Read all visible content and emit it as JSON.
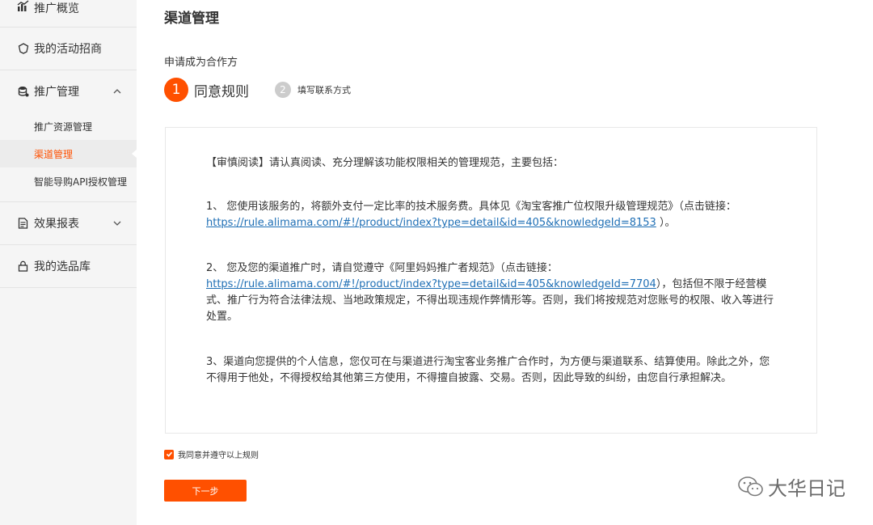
{
  "sidebar": {
    "overview": "推广概览",
    "activity": "我的活动招商",
    "promo_manage": "推广管理",
    "promo_sub": [
      {
        "label": "推广资源管理",
        "active": false
      },
      {
        "label": "渠道管理",
        "active": true
      },
      {
        "label": "智能导购API授权管理",
        "active": false
      }
    ],
    "report": "效果报表",
    "library": "我的选品库"
  },
  "main": {
    "title": "渠道管理",
    "section_title": "申请成为合作方",
    "steps": [
      {
        "num": "1",
        "label": "同意规则"
      },
      {
        "num": "2",
        "label": "填写联系方式"
      }
    ],
    "rules": {
      "intro": "【审慎阅读】请认真阅读、充分理解该功能权限相关的管理规范，主要包括：",
      "item1_text": "1、 您使用该服务的，将额外支付一定比率的技术服务费。具体见《淘宝客推广位权限升级管理规范》（点击链接：",
      "item1_link": "https://rule.alimama.com/#!/product/index?type=detail&id=405&knowledgeId=8153",
      "item1_tail": "）。",
      "item2_text": "2、 您及您的渠道推广时，请自觉遵守《阿里妈妈推广者规范》（点击链接：",
      "item2_link": "https://rule.alimama.com/#!/product/index?type=detail&id=405&knowledgeId=7704",
      "item2_tail": "），包括但不限于经营模式、推广行为符合法律法规、当地政策规定，不得出现违规作弊情形等。否则，我们将按规范对您账号的权限、收入等进行处置。",
      "item3_text": "3、渠道向您提供的个人信息，您仅可在与渠道进行淘宝客业务推广合作时，为方便与渠道联系、结算使用。除此之外，您不得用于他处，不得授权给其他第三方使用，不得擅自披露、交易。否则，因此导致的纠纷，由您自行承担解决。"
    },
    "agree_label": "我同意并遵守以上规则",
    "next_button": "下一步",
    "watermark": "大华日记"
  },
  "colors": {
    "accent": "#ff5000",
    "link": "#1f6fb5"
  }
}
